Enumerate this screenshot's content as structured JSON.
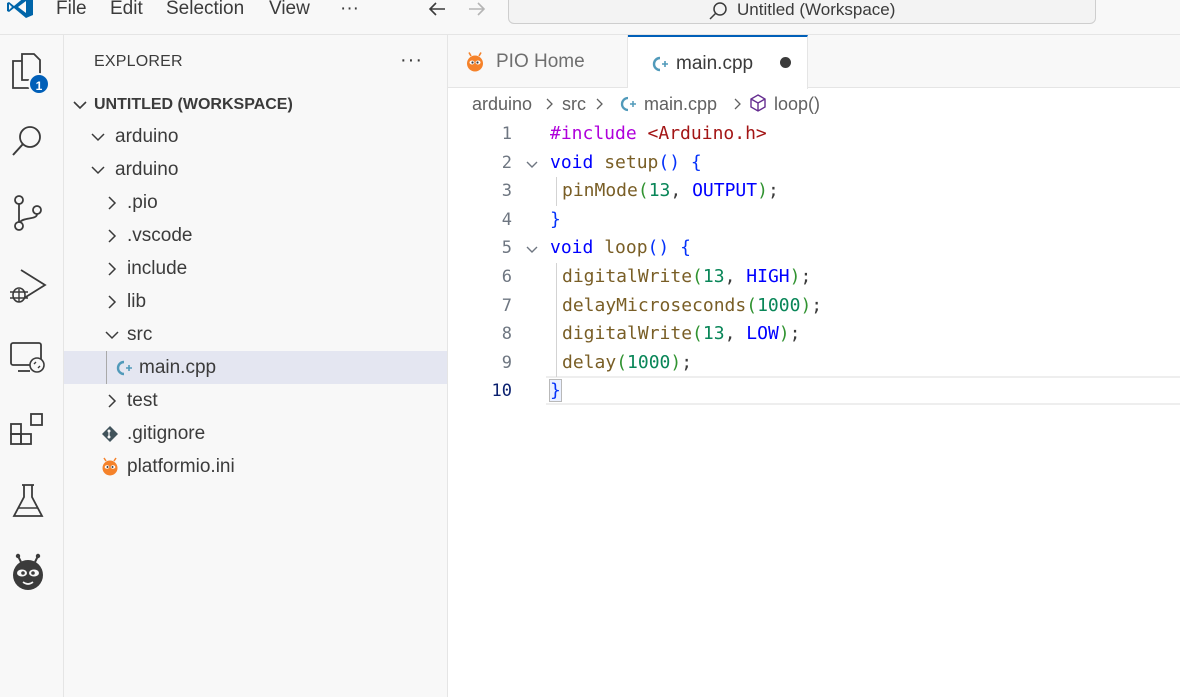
{
  "titlebar": {
    "menu": [
      "File",
      "Edit",
      "Selection",
      "View",
      "···"
    ],
    "command_center": "Untitled (Workspace)"
  },
  "activitybar": {
    "items": [
      "explorer-icon",
      "search-icon",
      "source-control-icon",
      "run-debug-icon",
      "remote-explorer-icon",
      "extensions-icon",
      "testing-icon",
      "platformio-icon"
    ],
    "explorer_badge": "1"
  },
  "sidebar": {
    "title": "EXPLORER",
    "more": "···",
    "workspace": "UNTITLED (WORKSPACE)",
    "tree": [
      {
        "label": "arduino",
        "kind": "folder-open"
      },
      {
        "label": "arduino",
        "kind": "folder-open"
      },
      {
        "label": ".pio",
        "kind": "folder"
      },
      {
        "label": ".vscode",
        "kind": "folder"
      },
      {
        "label": "include",
        "kind": "folder"
      },
      {
        "label": "lib",
        "kind": "folder"
      },
      {
        "label": "src",
        "kind": "folder-open"
      },
      {
        "label": "main.cpp",
        "kind": "cpp-file"
      },
      {
        "label": "test",
        "kind": "folder"
      },
      {
        "label": ".gitignore",
        "kind": "git-file"
      },
      {
        "label": "platformio.ini",
        "kind": "platformio-file"
      }
    ]
  },
  "tabs": [
    {
      "label": "PIO Home",
      "active": false
    },
    {
      "label": "main.cpp",
      "active": true,
      "dirty": true
    }
  ],
  "breadcrumb": [
    "arduino",
    "src",
    "main.cpp",
    "loop()"
  ],
  "editor": {
    "line_numbers": [
      "1",
      "2",
      "3",
      "4",
      "5",
      "6",
      "7",
      "8",
      "9",
      "10"
    ],
    "current_line": "10",
    "lines": [
      [
        {
          "t": "#include ",
          "c": "pre"
        },
        {
          "t": "<Arduino.h>",
          "c": "str"
        }
      ],
      [
        {
          "t": "void ",
          "c": "kw"
        },
        {
          "t": "setup",
          "c": "fn"
        },
        {
          "t": "() ",
          "c": "br1"
        },
        {
          "t": "{",
          "c": "br1"
        }
      ],
      [
        {
          "t": "pinMode",
          "c": "fn"
        },
        {
          "t": "(",
          "c": "br2"
        },
        {
          "t": "13",
          "c": "num"
        },
        {
          "t": ", ",
          "c": "p"
        },
        {
          "t": "OUTPUT",
          "c": "const"
        },
        {
          "t": ")",
          "c": "br2"
        },
        {
          "t": ";",
          "c": "p"
        }
      ],
      [
        {
          "t": "}",
          "c": "br1"
        }
      ],
      [
        {
          "t": "void ",
          "c": "kw"
        },
        {
          "t": "loop",
          "c": "fn"
        },
        {
          "t": "() ",
          "c": "br1"
        },
        {
          "t": "{",
          "c": "br1"
        }
      ],
      [
        {
          "t": "digitalWrite",
          "c": "fn"
        },
        {
          "t": "(",
          "c": "br2"
        },
        {
          "t": "13",
          "c": "num"
        },
        {
          "t": ", ",
          "c": "p"
        },
        {
          "t": "HIGH",
          "c": "const"
        },
        {
          "t": ")",
          "c": "br2"
        },
        {
          "t": ";",
          "c": "p"
        }
      ],
      [
        {
          "t": "delayMicroseconds",
          "c": "fn"
        },
        {
          "t": "(",
          "c": "br2"
        },
        {
          "t": "1000",
          "c": "num"
        },
        {
          "t": ")",
          "c": "br2"
        },
        {
          "t": ";",
          "c": "p"
        }
      ],
      [
        {
          "t": "digitalWrite",
          "c": "fn"
        },
        {
          "t": "(",
          "c": "br2"
        },
        {
          "t": "13",
          "c": "num"
        },
        {
          "t": ", ",
          "c": "p"
        },
        {
          "t": "LOW",
          "c": "const"
        },
        {
          "t": ")",
          "c": "br2"
        },
        {
          "t": ";",
          "c": "p"
        }
      ],
      [
        {
          "t": "delay",
          "c": "fn"
        },
        {
          "t": "(",
          "c": "br2"
        },
        {
          "t": "1000",
          "c": "num"
        },
        {
          "t": ")",
          "c": "br2"
        },
        {
          "t": ";",
          "c": "p"
        }
      ],
      [
        {
          "t": "}",
          "c": "br1"
        }
      ]
    ],
    "indented_lines": [
      3,
      6,
      7,
      8,
      9
    ],
    "foldable_lines": [
      2,
      5
    ]
  },
  "colors": {
    "accent": "#005fb8",
    "selection": "#e4e6f1",
    "platformio": "#f5822a"
  }
}
